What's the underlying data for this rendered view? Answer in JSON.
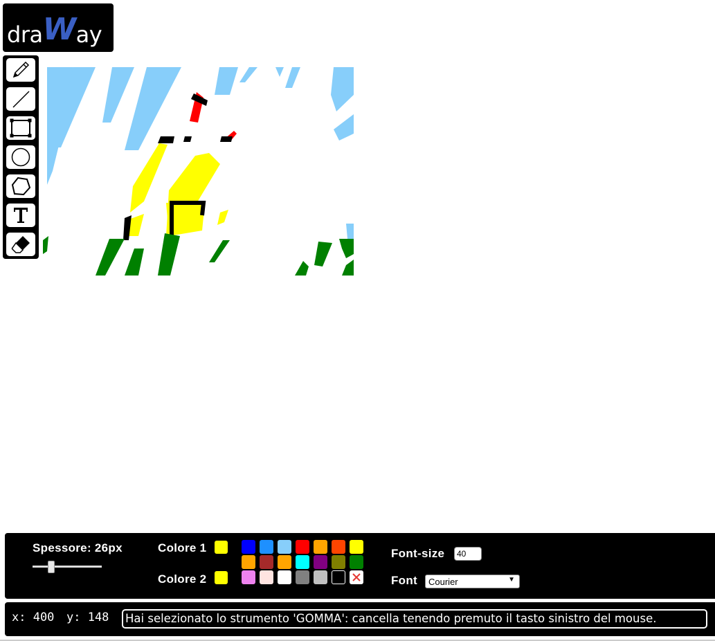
{
  "app": {
    "logo_prefix": "dra",
    "logo_w": "W",
    "logo_suffix": "ay"
  },
  "tools": [
    {
      "name": "pencil-icon",
      "id": "pencil"
    },
    {
      "name": "line-icon",
      "id": "line"
    },
    {
      "name": "rectangle-icon",
      "id": "rectangle"
    },
    {
      "name": "circle-icon",
      "id": "circle"
    },
    {
      "name": "polygon-icon",
      "id": "polygon"
    },
    {
      "name": "text-icon",
      "id": "text"
    },
    {
      "name": "eraser-icon",
      "id": "eraser"
    }
  ],
  "controls": {
    "thickness_label": "Spessore: 26px",
    "thickness_value": 26,
    "color1_label": "Colore 1",
    "color1_value": "#ffff00",
    "color2_label": "Colore 2",
    "color2_value": "#ffff00",
    "fontsize_label": "Font-size",
    "fontsize_value": "40",
    "font_label": "Font",
    "font_value": "Courier"
  },
  "palette": [
    [
      "#0000ff",
      "#1e90ff",
      "#87cefa",
      "#ff0000",
      "#ffa500",
      "#ff4500",
      "#ffff00"
    ],
    [
      "#ffa500",
      "#a52a2a",
      "#ffa500",
      "#00ffff",
      "#800080",
      "#808000",
      "#008000"
    ],
    [
      "#ee82ee",
      "#ffe4e1",
      "#ffffff",
      "#808080",
      "#c0c0c0",
      "#000000",
      "clear"
    ]
  ],
  "status": {
    "x_text": "x: 400",
    "y_text": "y: 148",
    "message": "Hai selezionato lo strumento 'GOMMA': cancella tenendo premuto il tasto sinistro del mouse."
  }
}
